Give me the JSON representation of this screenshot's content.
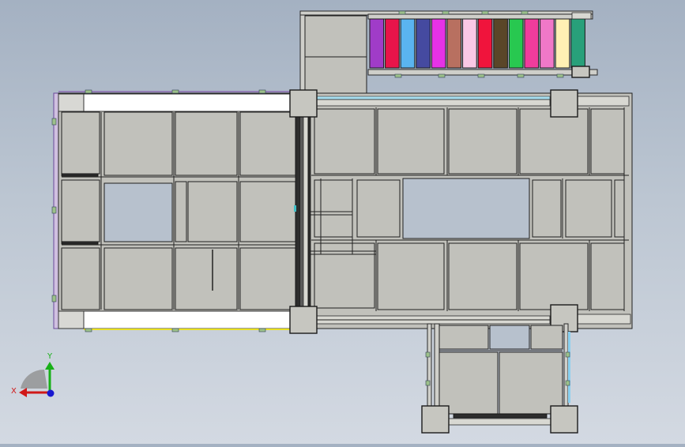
{
  "viewport": {
    "background_top": "#a4b1c2",
    "background_bottom": "#d3d9e2",
    "panel_color": "#c1c1bb",
    "edge_color": "#1f1f1f"
  },
  "cable_chain": {
    "link_colors": [
      "#a03cc8",
      "#e8144a",
      "#5ab4f0",
      "#454aa0",
      "#e632e6",
      "#b87060",
      "#fac8e6",
      "#f0143c",
      "#5a4628",
      "#28c850",
      "#f03c9c",
      "#f078c8",
      "#fff0b4",
      "#28a07a"
    ]
  },
  "triad": {
    "x_label": "X",
    "y_label": "Y",
    "x_color": "#d01818",
    "y_color": "#18b018",
    "z_color": "#1818d0",
    "icon": "coordinate-triad-icon"
  }
}
